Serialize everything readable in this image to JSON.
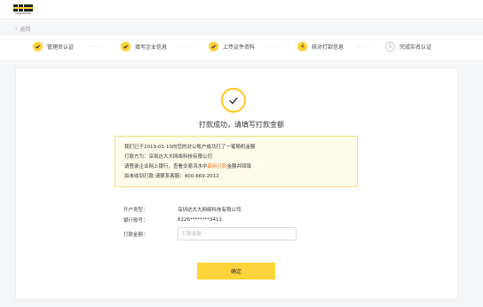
{
  "header": {
    "logo_icon": "brand-logo-icon"
  },
  "nav": {
    "back_label": "返回"
  },
  "steps": [
    {
      "label": "管理员认证",
      "status": "done"
    },
    {
      "label": "填写企业信息",
      "status": "done"
    },
    {
      "label": "上传证件资料",
      "status": "done"
    },
    {
      "number": "4",
      "label": "核对打款信息",
      "status": "active"
    },
    {
      "number": "5",
      "label": "完成实名认证",
      "status": "todo"
    }
  ],
  "step_separator": "······",
  "result": {
    "title": "打款成功，请填写打款金额",
    "icon": "check-circle-icon"
  },
  "notice": {
    "line1": "我们已于2019-01-10向您的对公账户成功打了一笔随机金额",
    "line2": "打款方为：深圳达大大网络科技有限公司",
    "line3_pre": "请登录企业网上银行，查看交易流水中",
    "line3_highlight": "最新打款",
    "line3_post": "金额并回填",
    "line4": "如未收到打款,请联系客服：400-869-2012"
  },
  "details": {
    "account_type_label": "开户类型：",
    "account_type_value": "深圳达大大网络科技有限公司",
    "bank_account_label": "银行账号：",
    "bank_account_value": "6226********3411",
    "amount_label": "打款金额：",
    "amount_placeholder": "打款金额",
    "amount_value": ""
  },
  "actions": {
    "confirm_label": "确定"
  },
  "colors": {
    "accent": "#ffd43b",
    "highlight": "#ff7a2e",
    "notice_bg": "#fffbea"
  }
}
